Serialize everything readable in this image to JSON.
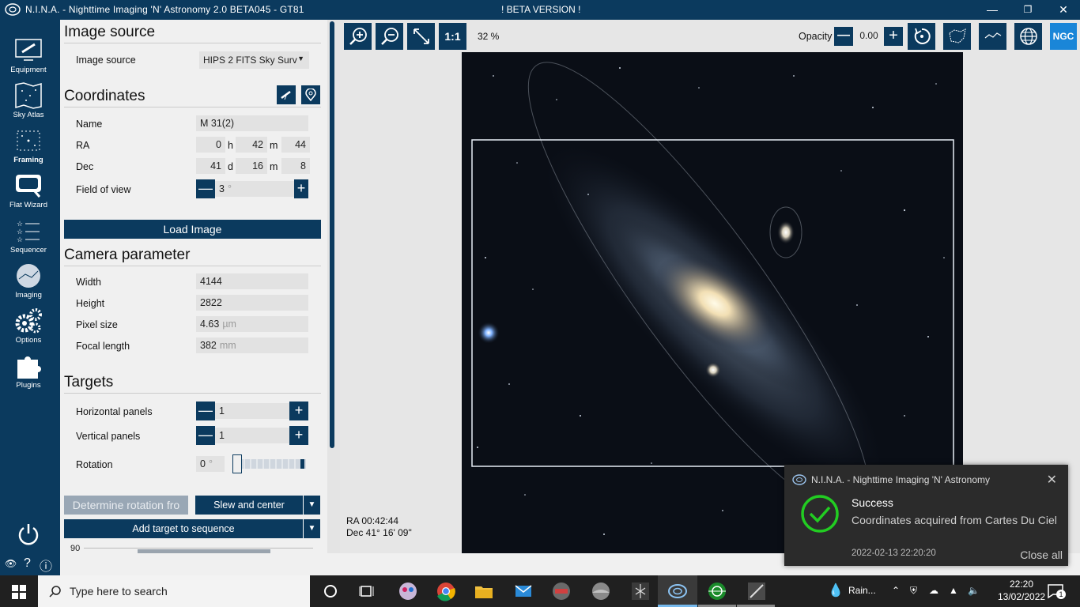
{
  "window": {
    "title": "N.I.N.A. - Nighttime Imaging 'N' Astronomy 2.0 BETA045  -  GT81",
    "beta_label": "! BETA VERSION !",
    "minimize": "—",
    "maximize": "❐",
    "close": "✕"
  },
  "sidebar": {
    "items": [
      {
        "label": "Equipment",
        "icon": "telescope-icon"
      },
      {
        "label": "Sky Atlas",
        "icon": "sky-atlas-icon"
      },
      {
        "label": "Framing",
        "icon": "framing-icon",
        "active": true
      },
      {
        "label": "Flat Wizard",
        "icon": "flat-wizard-icon"
      },
      {
        "label": "Sequencer",
        "icon": "sequencer-icon"
      },
      {
        "label": "Imaging",
        "icon": "imaging-icon"
      },
      {
        "label": "Options",
        "icon": "gears-icon"
      },
      {
        "label": "Plugins",
        "icon": "puzzle-icon"
      }
    ],
    "bottom_help": "?",
    "bottom_info": "ⓘ"
  },
  "panel": {
    "image_source_section": "Image source",
    "image_source_label": "Image source",
    "image_source_value": "HIPS 2 FITS Sky Surv",
    "coordinates_section": "Coordinates",
    "name_label": "Name",
    "name_value": "M 31(2)",
    "ra_label": "RA",
    "ra_h": "0",
    "ra_h_unit": "h",
    "ra_m": "42",
    "ra_m_unit": "m",
    "ra_s": "44",
    "dec_label": "Dec",
    "dec_d": "41",
    "dec_d_unit": "d",
    "dec_m": "16",
    "dec_m_unit": "m",
    "dec_s": "8",
    "fov_label": "Field of view",
    "fov_value": "3",
    "fov_unit": "°",
    "load_image": "Load Image",
    "camera_section": "Camera parameter",
    "width_label": "Width",
    "width_value": "4144",
    "height_label": "Height",
    "height_value": "2822",
    "pixel_label": "Pixel size",
    "pixel_value": "4.63",
    "pixel_unit": "µm",
    "focal_label": "Focal length",
    "focal_value": "382",
    "focal_unit": "mm",
    "targets_section": "Targets",
    "hpanels_label": "Horizontal panels",
    "hpanels_value": "1",
    "vpanels_label": "Vertical panels",
    "vpanels_value": "1",
    "rotation_label": "Rotation",
    "rotation_value": "0",
    "rotation_unit": "°",
    "determine_rotation": "Determine rotation fro",
    "slew_center": "Slew and center",
    "add_target": "Add target to sequence",
    "scale_value": "90",
    "minus": "—",
    "plus": "+"
  },
  "viewer": {
    "zoom_level": "32 %",
    "one_to_one": "1:1",
    "opacity_label": "Opacity",
    "opacity_value": "0.00",
    "ngc_label": "NGC",
    "ra_readout": "RA  00:42:44",
    "dec_readout": "Dec  41° 16' 09\""
  },
  "toast": {
    "app": "N.I.N.A. - Nighttime Imaging 'N' Astronomy",
    "title": "Success",
    "message": "Coordinates acquired from Cartes Du Ciel",
    "time": "2022-02-13 22:20:20",
    "close_all": "Close all",
    "status_color": "#22cc22"
  },
  "taskbar": {
    "search_placeholder": "Type here to search",
    "weather": "Rain...",
    "time": "22:20",
    "date": "13/02/2022",
    "notification_count": "1"
  },
  "colors": {
    "accent": "#0b3a5e",
    "panel_bg": "#f0f0f0"
  }
}
